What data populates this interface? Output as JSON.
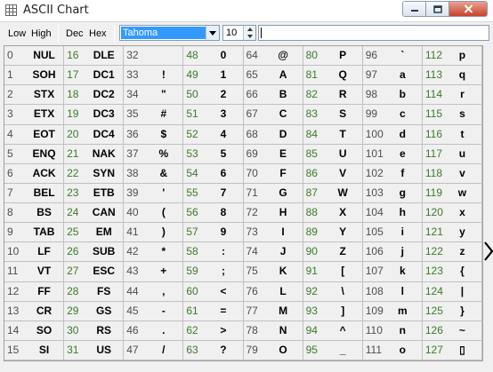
{
  "window": {
    "title": "ASCII Chart"
  },
  "toolbar": {
    "low_label": "Low",
    "high_label": "High",
    "dec_label": "Dec",
    "hex_label": "Hex",
    "font_value": "Tahoma",
    "size_value": "10",
    "text_value": ""
  },
  "colors": {
    "code_dark": "#4d4d4d",
    "code_green": "#3a7a28",
    "selection": "#3399ff"
  },
  "chart": {
    "codes": [
      "0",
      "1",
      "2",
      "3",
      "4",
      "5",
      "6",
      "7",
      "8",
      "9",
      "10",
      "11",
      "12",
      "13",
      "14",
      "15",
      "16",
      "17",
      "18",
      "19",
      "20",
      "21",
      "22",
      "23",
      "24",
      "25",
      "26",
      "27",
      "28",
      "29",
      "30",
      "31",
      "32",
      "33",
      "34",
      "35",
      "36",
      "37",
      "38",
      "39",
      "40",
      "41",
      "42",
      "43",
      "44",
      "45",
      "46",
      "47",
      "48",
      "49",
      "50",
      "51",
      "52",
      "53",
      "54",
      "55",
      "56",
      "57",
      "58",
      "59",
      "60",
      "61",
      "62",
      "63",
      "64",
      "65",
      "66",
      "67",
      "68",
      "69",
      "70",
      "71",
      "72",
      "73",
      "74",
      "75",
      "76",
      "77",
      "78",
      "79",
      "80",
      "81",
      "82",
      "83",
      "84",
      "85",
      "86",
      "87",
      "88",
      "89",
      "90",
      "91",
      "92",
      "93",
      "94",
      "95",
      "96",
      "97",
      "98",
      "99",
      "100",
      "101",
      "102",
      "103",
      "104",
      "105",
      "106",
      "107",
      "108",
      "109",
      "110",
      "111",
      "112",
      "113",
      "114",
      "115",
      "116",
      "117",
      "118",
      "119",
      "120",
      "121",
      "122",
      "123",
      "124",
      "125",
      "126",
      "127"
    ],
    "chars": [
      "NUL",
      "SOH",
      "STX",
      "ETX",
      "EOT",
      "ENQ",
      "ACK",
      "BEL",
      "BS",
      "TAB",
      "LF",
      "VT",
      "FF",
      "CR",
      "SO",
      "SI",
      "DLE",
      "DC1",
      "DC2",
      "DC3",
      "DC4",
      "NAK",
      "SYN",
      "ETB",
      "CAN",
      "EM",
      "SUB",
      "ESC",
      "FS",
      "GS",
      "RS",
      "US",
      "",
      "!",
      "\"",
      "#",
      "$",
      "%",
      "&",
      "'",
      "(",
      ")",
      "*",
      "+",
      ",",
      "-",
      ".",
      "/",
      "0",
      "1",
      "2",
      "3",
      "4",
      "5",
      "6",
      "7",
      "8",
      "9",
      ":",
      ";",
      "<",
      "=",
      ">",
      "?",
      "@",
      "A",
      "B",
      "C",
      "D",
      "E",
      "F",
      "G",
      "H",
      "I",
      "J",
      "K",
      "L",
      "M",
      "N",
      "O",
      "P",
      "Q",
      "R",
      "S",
      "T",
      "U",
      "V",
      "W",
      "X",
      "Y",
      "Z",
      "[",
      "\\",
      "]",
      "^",
      "_",
      "`",
      "a",
      "b",
      "c",
      "d",
      "e",
      "f",
      "g",
      "h",
      "i",
      "j",
      "k",
      "l",
      "m",
      "n",
      "o",
      "p",
      "q",
      "r",
      "s",
      "t",
      "u",
      "v",
      "w",
      "x",
      "y",
      "z",
      "{",
      "|",
      "}",
      "~",
      "▯"
    ]
  }
}
